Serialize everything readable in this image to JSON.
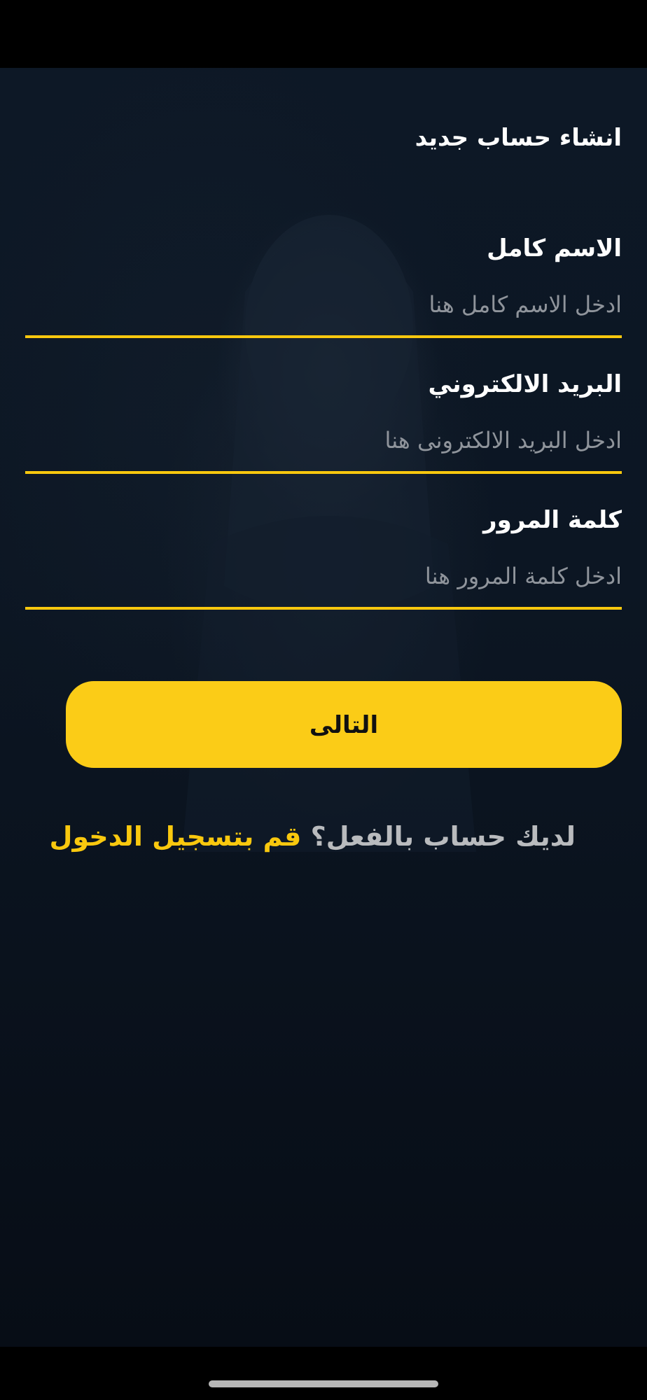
{
  "title": "انشاء حساب جديد",
  "fields": [
    {
      "label": "الاسم كامل",
      "placeholder": "ادخل الاسم كامل هنا"
    },
    {
      "label": "البريد الالكتروني",
      "placeholder": "ادخل البريد الالكترونى هنا"
    },
    {
      "label": "كلمة المرور",
      "placeholder": "ادخل كلمة المرور هنا"
    }
  ],
  "next_button": {
    "label": "التالى"
  },
  "login_prompt": {
    "question": "لديك حساب بالفعل؟ ",
    "link": "قم بتسجيل الدخول"
  },
  "colors": {
    "accent": "#f9c80e",
    "button_fill": "#fbcc17",
    "background": "#0c1623"
  }
}
